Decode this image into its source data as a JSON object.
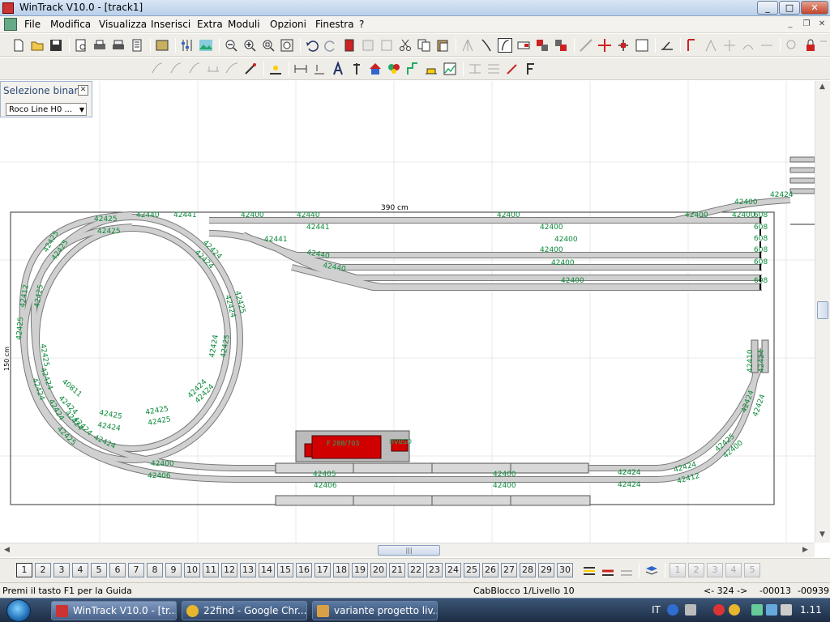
{
  "window": {
    "title": "WinTrack  V10.0 - [track1]",
    "min": "_",
    "max": "□",
    "close": "✕"
  },
  "menubar": {
    "items": [
      "File",
      "Modifica",
      "Visualizza",
      "Inserisci",
      "Extra",
      "Moduli",
      "Opzioni",
      "Finestra",
      "?"
    ]
  },
  "mdi": {
    "min": "_",
    "restore": "❐",
    "close": "✕"
  },
  "selection_panel": {
    "title": "Selezione binari",
    "close": "✕",
    "selected": "Roco Line H0 ..."
  },
  "canvas": {
    "dimension_top": "390 cm",
    "dimension_side": "150 cm",
    "track_labels": [
      "42425",
      "42425",
      "42440",
      "42441",
      "42400",
      "42440",
      "42400",
      "42400",
      "42400",
      "42400",
      "42400",
      "42400",
      "42400",
      "42400",
      "42425",
      "42425",
      "42424",
      "42424",
      "42425",
      "42424",
      "42441",
      "42440",
      "42440",
      "42441",
      "42400",
      "42400",
      "42400",
      "42400",
      "42400",
      "608",
      "608",
      "608",
      "608",
      "608",
      "608",
      "608",
      "42440",
      "42400",
      "42410",
      "42410",
      "42424",
      "42424",
      "42424",
      "42425",
      "42400",
      "42400",
      "42406",
      "42405",
      "42406",
      "42400",
      "42400",
      "42424",
      "42424",
      "42424",
      "42412",
      "42412",
      "42425",
      "42425",
      "42425",
      "40811",
      "42424",
      "42425",
      "42424",
      "42425",
      "42425",
      "42424",
      "42424",
      "42424",
      "42425",
      "42424",
      "42424",
      "42424",
      "42424",
      "42424",
      "42425",
      "42424",
      "42424"
    ],
    "train_label": "F 288/703",
    "train_label2": "HVBSD"
  },
  "layers": {
    "buttons": [
      "1",
      "2",
      "3",
      "4",
      "5",
      "6",
      "7",
      "8",
      "9",
      "10",
      "11",
      "12",
      "13",
      "14",
      "15",
      "16",
      "17",
      "18",
      "19",
      "20",
      "21",
      "22",
      "23",
      "24",
      "25",
      "26",
      "27",
      "28",
      "29",
      "30"
    ],
    "extra": [
      "1",
      "2",
      "3",
      "4",
      "5"
    ],
    "active": "1"
  },
  "statusbar": {
    "help": "Premi il tasto F1 per la Guida",
    "block": "CabBlocco 1/Livello 10",
    "nav": "<- 324 ->",
    "x": "-00013",
    "y": "-00939"
  },
  "taskbar": {
    "items": [
      {
        "label": "WinTrack  V10.0 - [tr...",
        "icon_color": "#c33"
      },
      {
        "label": "22find - Google Chr...",
        "icon_color": "#e8b62c"
      },
      {
        "label": "variante progetto liv...",
        "icon_color": "#d9a046"
      }
    ],
    "lang": "IT",
    "clock": "1.11"
  },
  "colors": {
    "track": "#c8c8c8",
    "label": "#0a8a3a",
    "train": "#d10000"
  }
}
